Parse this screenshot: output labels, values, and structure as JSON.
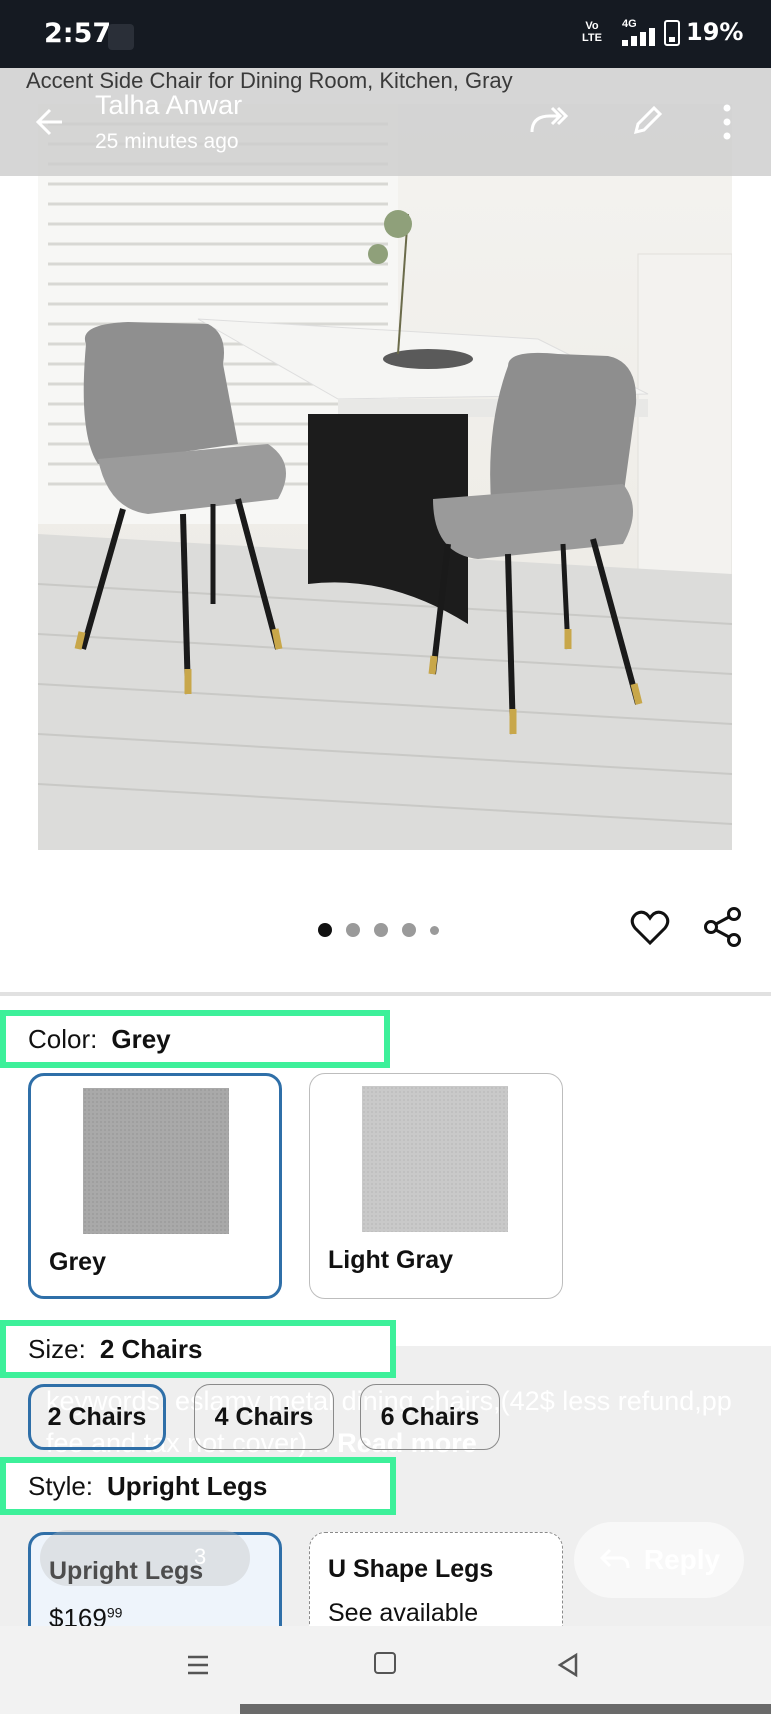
{
  "status_bar": {
    "time": "2:57",
    "volte_label": "Vo\nLTE",
    "network": "4G",
    "battery": "19%"
  },
  "header": {
    "page_title": "Accent Side Chair for Dining Room, Kitchen, Gray",
    "sender": "Talha Anwar",
    "time_ago": "25 minutes ago"
  },
  "carousel": {
    "dot_count": 5,
    "active_index": 0
  },
  "color": {
    "key": "Color:",
    "value": "Grey",
    "options": [
      {
        "name": "Grey",
        "swatch": "#a9a9a9",
        "selected": true
      },
      {
        "name": "Light Gray",
        "swatch": "#c9c9c9",
        "selected": false
      }
    ]
  },
  "size": {
    "key": "Size:",
    "value": "2 Chairs",
    "options": [
      "2 Chairs",
      "4 Chairs",
      "6 Chairs"
    ]
  },
  "style": {
    "key": "Style:",
    "value": "Upright Legs",
    "options": [
      {
        "name": "Upright Legs",
        "price_main": "$169",
        "price_cents": "99"
      },
      {
        "name": "U Shape Legs",
        "sub": "See available"
      }
    ]
  },
  "comment": {
    "text": "keywords: eslamy metal dining chairs,(42$ less refund,pp fee and tax not cover)...",
    "read_more": "Read more",
    "reply": "Reply",
    "reaction_count": "3"
  },
  "colors": {
    "highlight": "#3df09a",
    "selected_border": "#2f6fa8",
    "status_bar_bg": "#151a22"
  }
}
